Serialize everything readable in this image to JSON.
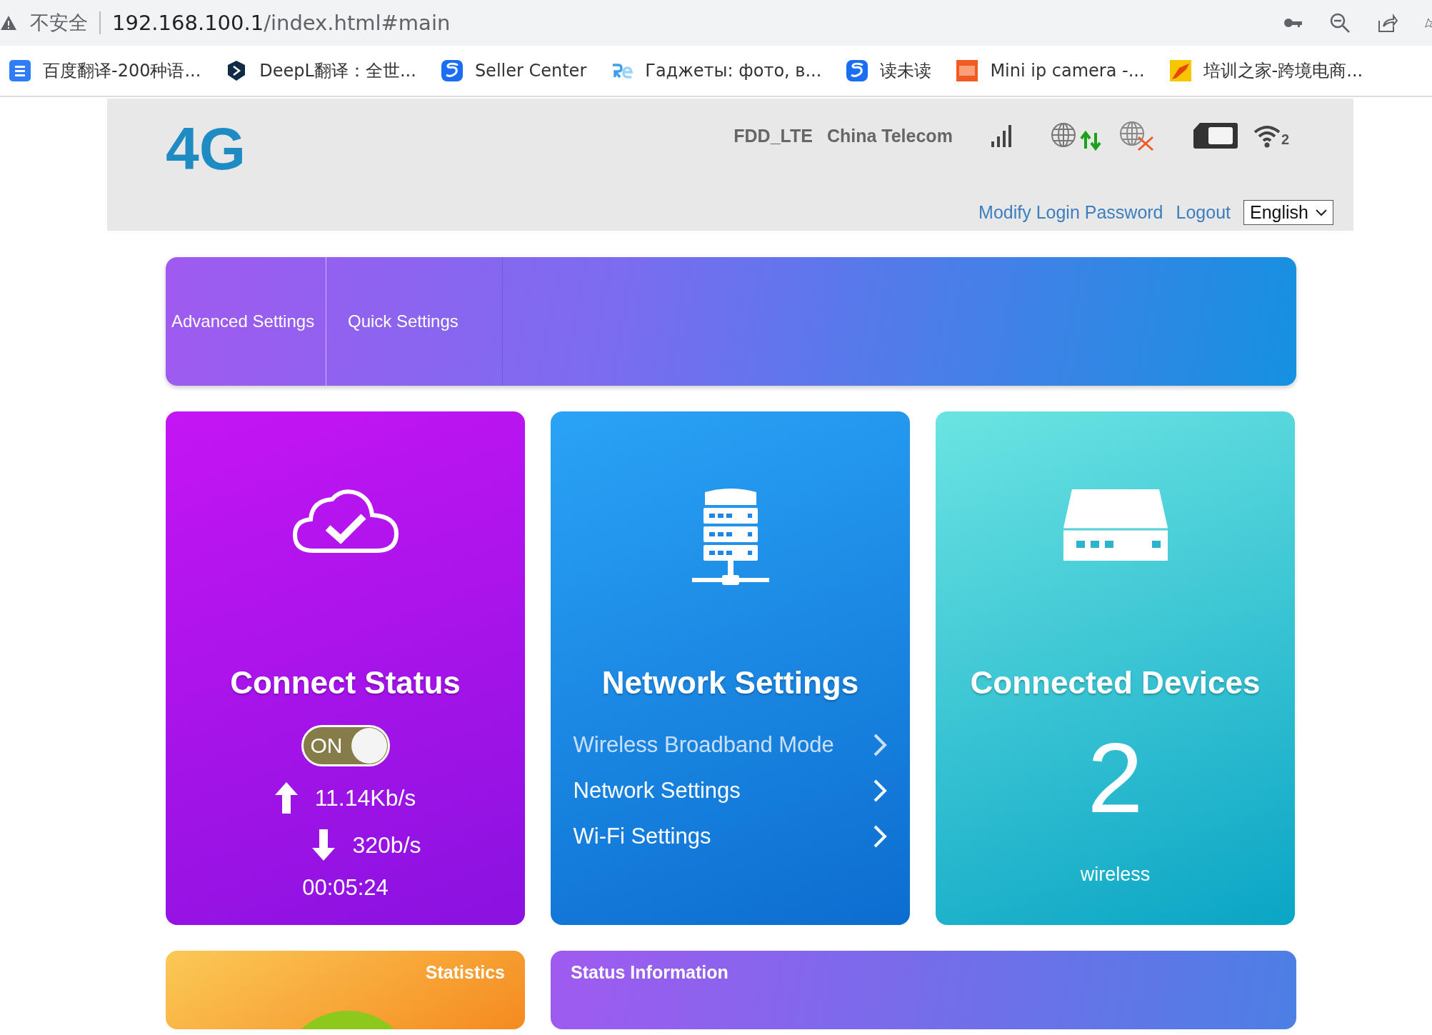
{
  "browser": {
    "security_label": "不安全",
    "url_host": "192.168.100.1",
    "url_path": "/index.html#main",
    "bookmarks": [
      {
        "label": "百度翻译-200种语..."
      },
      {
        "label": "DeepL翻译：全世..."
      },
      {
        "label": "Seller Center"
      },
      {
        "label": "Гаджеты: фото, в..."
      },
      {
        "label": "读未读"
      },
      {
        "label": "Mini ip camera -..."
      },
      {
        "label": "培训之家-跨境电商..."
      }
    ]
  },
  "header": {
    "logo": "4G",
    "network_type": "FDD_LTE",
    "operator": "China Telecom",
    "wifi_clients": "2",
    "links": [
      "Modify Login Password",
      "Logout"
    ],
    "language": "English"
  },
  "nav": {
    "tabs": [
      "Advanced Settings",
      "Quick Settings"
    ]
  },
  "cards": {
    "connect_status": {
      "title": "Connect Status",
      "switch": {
        "label": "ON",
        "on": true
      },
      "upload": "11.14Kb/s",
      "download": "320b/s",
      "uptime": "00:05:24"
    },
    "network_settings": {
      "title": "Network Settings",
      "links": [
        {
          "label": "Wireless Broadband Mode",
          "disabled": true
        },
        {
          "label": "Network Settings",
          "disabled": false
        },
        {
          "label": "Wi-Fi Settings",
          "disabled": false
        }
      ]
    },
    "connected_devices": {
      "title": "Connected Devices",
      "count": "2",
      "type": "wireless"
    }
  },
  "panels": {
    "statistics": {
      "title": "Statistics"
    },
    "status_information": {
      "title": "Status Information"
    }
  }
}
